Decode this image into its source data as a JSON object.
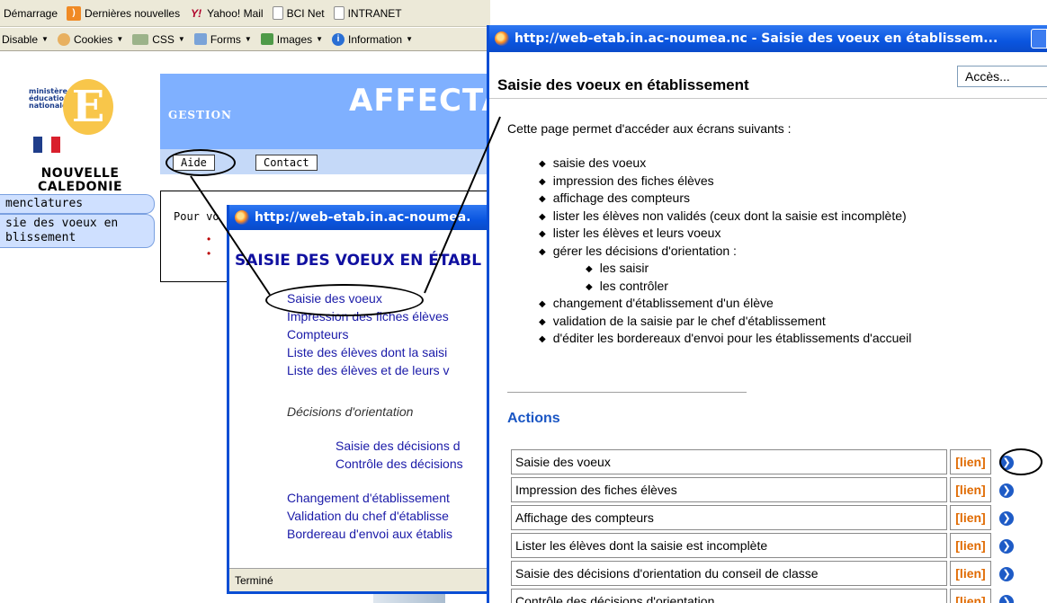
{
  "bookmarks_bar": {
    "items": [
      "Démarrage",
      "Dernières nouvelles",
      "Yahoo! Mail",
      "BCI Net",
      "INTRANET"
    ]
  },
  "dev_toolbar": {
    "items": [
      "Disable",
      "Cookies",
      "CSS",
      "Forms",
      "Images",
      "Information"
    ]
  },
  "background_page": {
    "logo_text_lines": [
      "ministère",
      "éducation",
      "nationale"
    ],
    "region_title": "NOUVELLE\nCALEDONIE",
    "banner_title": "AFFECTA",
    "banner_subtitle": "GESTION",
    "nav": [
      "menclatures",
      "sie des voeux en\nblissement"
    ],
    "menu_buttons": [
      "Aide",
      "Contact"
    ],
    "content_text": "Pour vo"
  },
  "popup_small": {
    "title": "http://web-etab.in.ac-noumea.",
    "heading": "SAISIE DES VOEUX EN ÉTABL",
    "links": [
      "Saisie des voeux",
      "Impression des fiches élèves",
      "Compteurs",
      "Liste des élèves dont la saisi",
      "Liste des élèves et de leurs v"
    ],
    "section_label": "Décisions d'orientation",
    "section_links": [
      "Saisie des décisions d",
      "Contrôle des décisions"
    ],
    "links_bottom": [
      "Changement d'établissement",
      "Validation du chef d'établisse",
      "Bordereau d'envoi aux établis"
    ],
    "status": "Terminé"
  },
  "popup_main": {
    "title": "http://web-etab.in.ac-noumea.nc - Saisie des voeux en établissem...",
    "page_title": "Saisie des voeux en établissement",
    "acces_select": "Accès...",
    "intro": "Cette page permet d'accéder aux écrans suivants :",
    "bullets": [
      {
        "text": "saisie des voeux",
        "sub": false
      },
      {
        "text": "impression des fiches élèves",
        "sub": false
      },
      {
        "text": "affichage des compteurs",
        "sub": false
      },
      {
        "text": "lister les élèves non validés (ceux dont la saisie est incomplète)",
        "sub": false
      },
      {
        "text": "lister les élèves et leurs voeux",
        "sub": false
      },
      {
        "text": "gérer les décisions d'orientation :",
        "sub": false
      },
      {
        "text": "les saisir",
        "sub": true
      },
      {
        "text": "les contrôler",
        "sub": true
      },
      {
        "text": "changement d'établissement d'un élève",
        "sub": false
      },
      {
        "text": "validation de la saisie par le chef d'établissement",
        "sub": false
      },
      {
        "text": "d'éditer les bordereaux d'envoi pour les établissements d'accueil",
        "sub": false
      }
    ],
    "actions_title": "Actions",
    "actions": [
      {
        "label": "Saisie des voeux",
        "link": "[lien]"
      },
      {
        "label": "Impression des fiches élèves",
        "link": "[lien]"
      },
      {
        "label": "Affichage des compteurs",
        "link": "[lien]"
      },
      {
        "label": "Lister les élèves dont la saisie est incomplète",
        "link": "[lien]"
      },
      {
        "label": "Saisie des décisions d'orientation du conseil de classe",
        "link": "[lien]"
      },
      {
        "label": "Contrôle des décisions d'orientation",
        "link": "[lien]"
      }
    ]
  },
  "colors": {
    "titlebar": "#0a55e0",
    "link": "#1a1aa8",
    "lien": "#e06a00",
    "actions_heading": "#1a56c4"
  }
}
